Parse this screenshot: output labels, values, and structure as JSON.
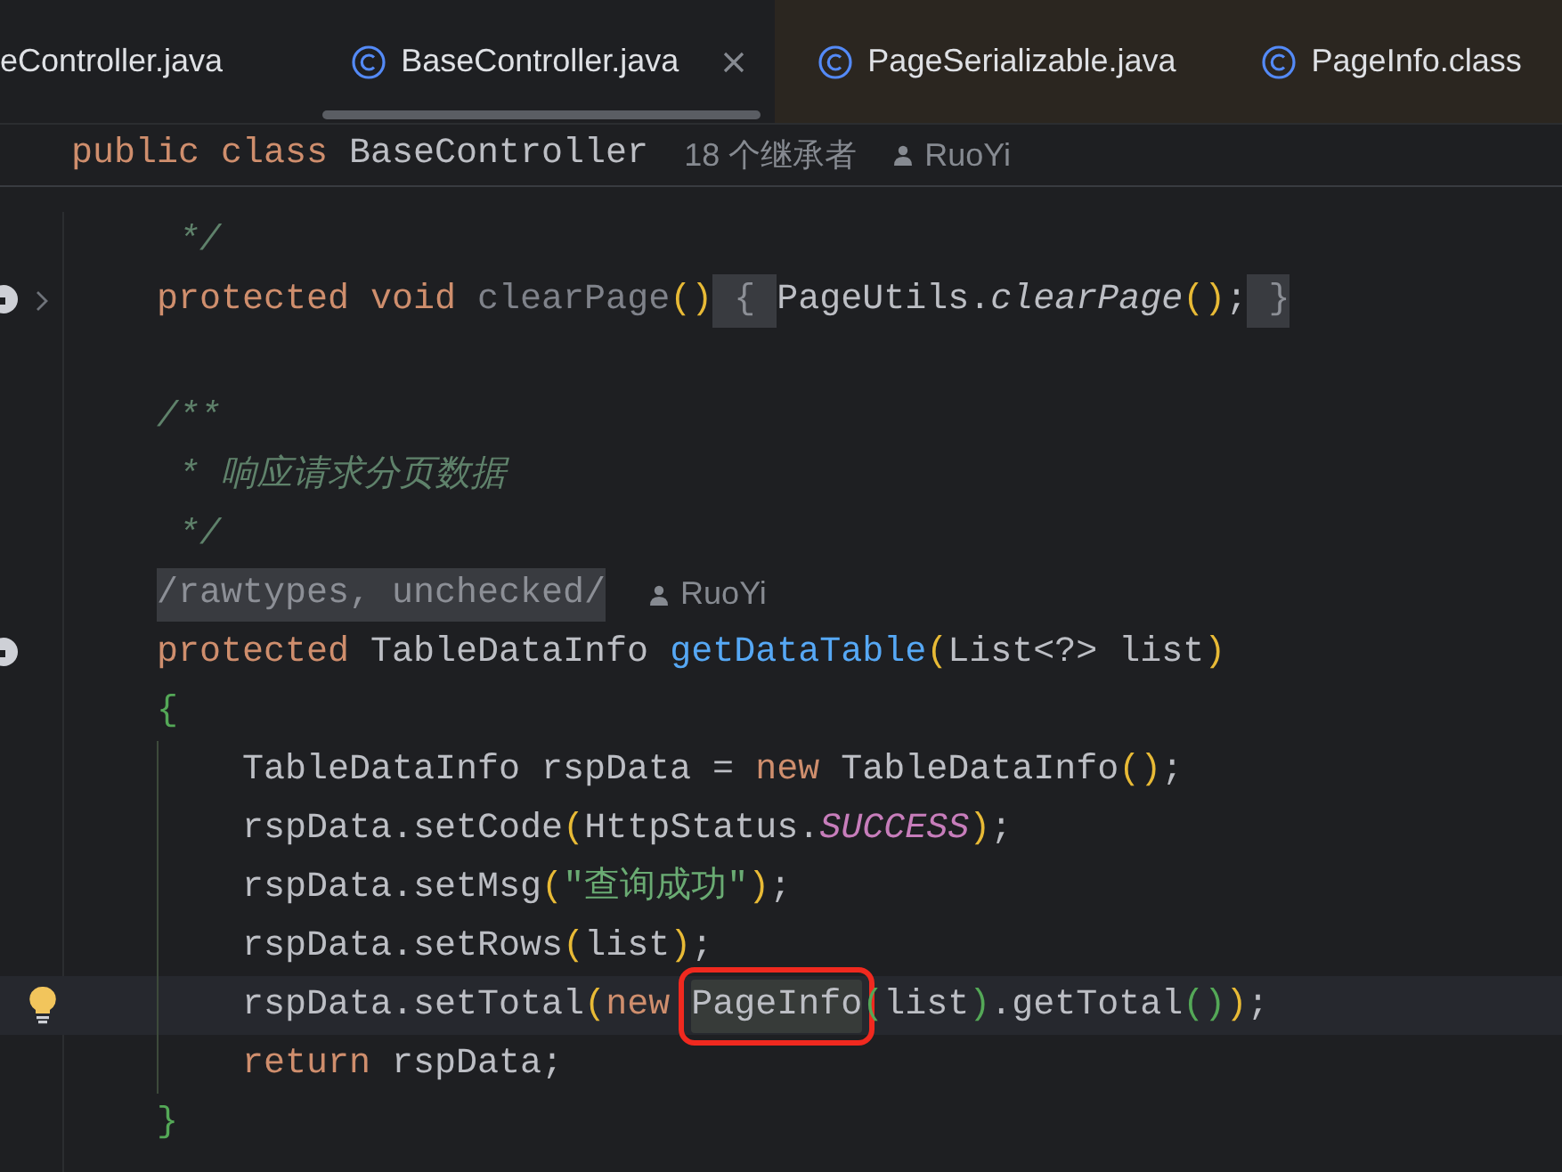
{
  "tabs": [
    {
      "label": "eController.java",
      "selected": false,
      "kind": "project",
      "icon": false,
      "closable": false
    },
    {
      "label": "BaseController.java",
      "selected": true,
      "kind": "project",
      "icon": true,
      "closable": true
    },
    {
      "label": "PageSerializable.java",
      "selected": false,
      "kind": "library",
      "icon": true,
      "closable": false
    },
    {
      "label": "PageInfo.class",
      "selected": false,
      "kind": "library",
      "icon": true,
      "closable": false
    }
  ],
  "sticky_header": {
    "tokens": [
      {
        "text": "public",
        "kind": "kw"
      },
      {
        "text": " class",
        "kind": "kw"
      },
      {
        "text": " BaseController",
        "kind": "plain"
      }
    ],
    "inheritors": "18 个继承者",
    "author": "RuoYi"
  },
  "lines": [
    {
      "tokens": [
        {
          "text": " */",
          "kind": "doc"
        }
      ]
    },
    {
      "marker": true,
      "folded": true,
      "tokens": [
        {
          "text": "protected",
          "kind": "kw"
        },
        {
          "text": " void",
          "kind": "kw"
        },
        {
          "text": " clearPage",
          "kind": "unused"
        },
        {
          "text": "()",
          "kind": "paren1"
        },
        {
          "text": " { ",
          "kind": "fold"
        },
        {
          "text": "PageUtils.",
          "kind": "plain"
        },
        {
          "text": "clearPage",
          "kind": "italic"
        },
        {
          "text": "()",
          "kind": "paren1"
        },
        {
          "text": ";",
          "kind": "plain"
        },
        {
          "text": " }",
          "kind": "fold"
        }
      ]
    },
    {
      "blank_before": true,
      "tokens": [
        {
          "text": "/**",
          "kind": "doc"
        }
      ]
    },
    {
      "tokens": [
        {
          "text": " * 响应请求分页数据",
          "kind": "doc"
        }
      ]
    },
    {
      "tokens": [
        {
          "text": " */",
          "kind": "doc"
        }
      ]
    },
    {
      "tokens": [
        {
          "text": "/rawtypes, unchecked/",
          "kind": "fold"
        },
        {
          "text": "RuoYi",
          "kind": "author"
        }
      ]
    },
    {
      "marker": true,
      "tokens": [
        {
          "text": "protected",
          "kind": "kw"
        },
        {
          "text": " TableDataInfo ",
          "kind": "plain"
        },
        {
          "text": "getDataTable",
          "kind": "decl"
        },
        {
          "text": "(",
          "kind": "paren1"
        },
        {
          "text": "List<?> list",
          "kind": "plain"
        },
        {
          "text": ")",
          "kind": "paren1"
        }
      ]
    },
    {
      "tokens": [
        {
          "text": "{",
          "kind": "paren2"
        }
      ]
    },
    {
      "guide": true,
      "tokens": [
        {
          "text": "    TableDataInfo rspData = ",
          "kind": "plain"
        },
        {
          "text": "new",
          "kind": "kw"
        },
        {
          "text": " TableDataInfo",
          "kind": "plain"
        },
        {
          "text": "()",
          "kind": "paren1"
        },
        {
          "text": ";",
          "kind": "plain"
        }
      ]
    },
    {
      "guide": true,
      "tokens": [
        {
          "text": "    rspData.setCode",
          "kind": "plain"
        },
        {
          "text": "(",
          "kind": "paren1"
        },
        {
          "text": "HttpStatus.",
          "kind": "plain"
        },
        {
          "text": "SUCCESS",
          "kind": "static"
        },
        {
          "text": ")",
          "kind": "paren1"
        },
        {
          "text": ";",
          "kind": "plain"
        }
      ]
    },
    {
      "guide": true,
      "tokens": [
        {
          "text": "    rspData.setMsg",
          "kind": "plain"
        },
        {
          "text": "(",
          "kind": "paren1"
        },
        {
          "text": "\"查询成功\"",
          "kind": "string"
        },
        {
          "text": ")",
          "kind": "paren1"
        },
        {
          "text": ";",
          "kind": "plain"
        }
      ]
    },
    {
      "guide": true,
      "tokens": [
        {
          "text": "    rspData.setRows",
          "kind": "plain"
        },
        {
          "text": "(",
          "kind": "paren1"
        },
        {
          "text": "list",
          "kind": "plain"
        },
        {
          "text": ")",
          "kind": "paren1"
        },
        {
          "text": ";",
          "kind": "plain"
        }
      ]
    },
    {
      "guide": true,
      "current": true,
      "bulb": true,
      "tokens": [
        {
          "text": "    rspData.setTotal",
          "kind": "plain"
        },
        {
          "text": "(",
          "kind": "paren1"
        },
        {
          "text": "new ",
          "kind": "kw"
        },
        {
          "text": "PageInfo",
          "kind": "boxed"
        },
        {
          "text": "(",
          "kind": "paren2"
        },
        {
          "text": "list",
          "kind": "plain"
        },
        {
          "text": ")",
          "kind": "paren2"
        },
        {
          "text": ".getTotal",
          "kind": "plain"
        },
        {
          "text": "()",
          "kind": "paren2"
        },
        {
          "text": ")",
          "kind": "paren1"
        },
        {
          "text": ";",
          "kind": "plain"
        }
      ]
    },
    {
      "guide": true,
      "tokens": [
        {
          "text": "    return",
          "kind": "kw"
        },
        {
          "text": " rspData;",
          "kind": "plain"
        }
      ]
    },
    {
      "tokens": [
        {
          "text": "}",
          "kind": "paren2"
        }
      ]
    }
  ]
}
